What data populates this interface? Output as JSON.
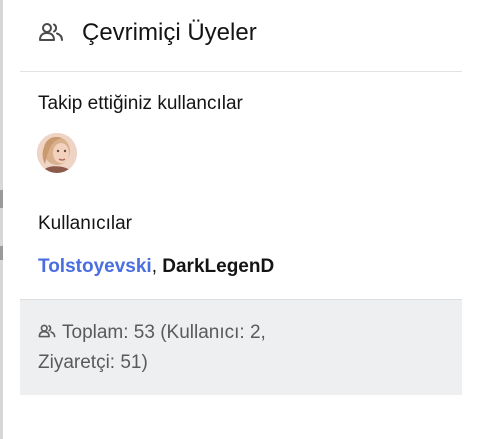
{
  "widget": {
    "title": "Çevrimiçi Üyeler",
    "header_icon": "users-icon",
    "followed_section": {
      "title": "Takip ettiğiniz kullancılar",
      "avatar": "user-avatar"
    },
    "users_section": {
      "title": "Kullanıcılar",
      "users": [
        {
          "name": "Tolstoyevski",
          "color": "#4a6ee0"
        },
        {
          "name": "DarkLegenD",
          "color": "#141414"
        }
      ],
      "separator": ", "
    },
    "footer": {
      "icon": "users-icon",
      "text": "Toplam: 53 (Kullanıcı: 2, Ziyaretçi: 51)"
    }
  },
  "colors": {
    "accent_link": "#4a6ee0",
    "footer_bg": "#eeeff1",
    "divider": "#e2e2e2"
  }
}
